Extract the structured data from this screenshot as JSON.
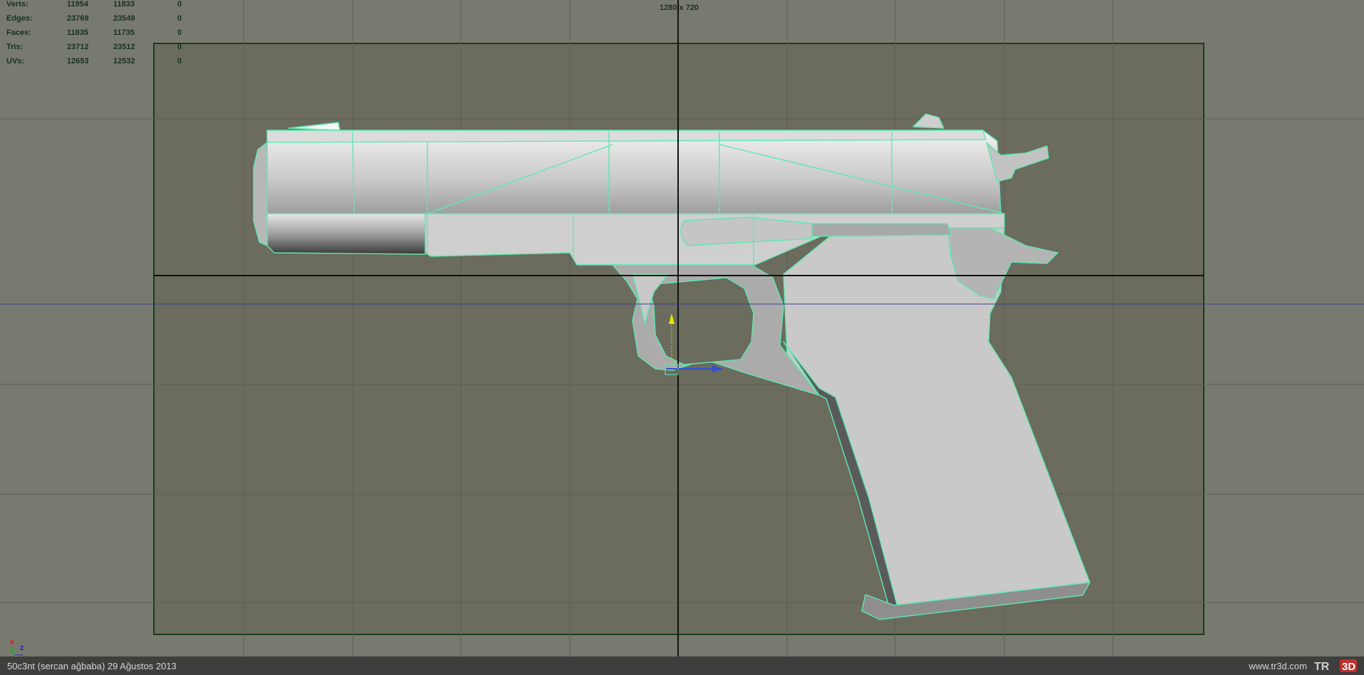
{
  "stats": {
    "rows": [
      {
        "label": "Verts:",
        "v1": "11954",
        "v2": "11833",
        "v3": "0"
      },
      {
        "label": "Edges:",
        "v1": "23769",
        "v2": "23549",
        "v3": "0"
      },
      {
        "label": "Faces:",
        "v1": "11835",
        "v2": "11735",
        "v3": "0"
      },
      {
        "label": "Tris:",
        "v1": "23712",
        "v2": "23512",
        "v3": "0"
      },
      {
        "label": "UVs:",
        "v1": "12653",
        "v2": "12532",
        "v3": "0"
      }
    ]
  },
  "viewport": {
    "resolution": "1280 x 720",
    "axis_x": "x",
    "axis_y": "y",
    "axis_z": "z"
  },
  "status": {
    "left": "50c3nt (sercan ağbaba)  29 Ağustos 2013",
    "right": "www.tr3d.com",
    "logo_text": "TR3D"
  },
  "colors": {
    "background": "#797a6f",
    "gate_fill": "#6b6b5e",
    "wire": "#5ee8b0",
    "status_bar": "#3e3e3e"
  }
}
